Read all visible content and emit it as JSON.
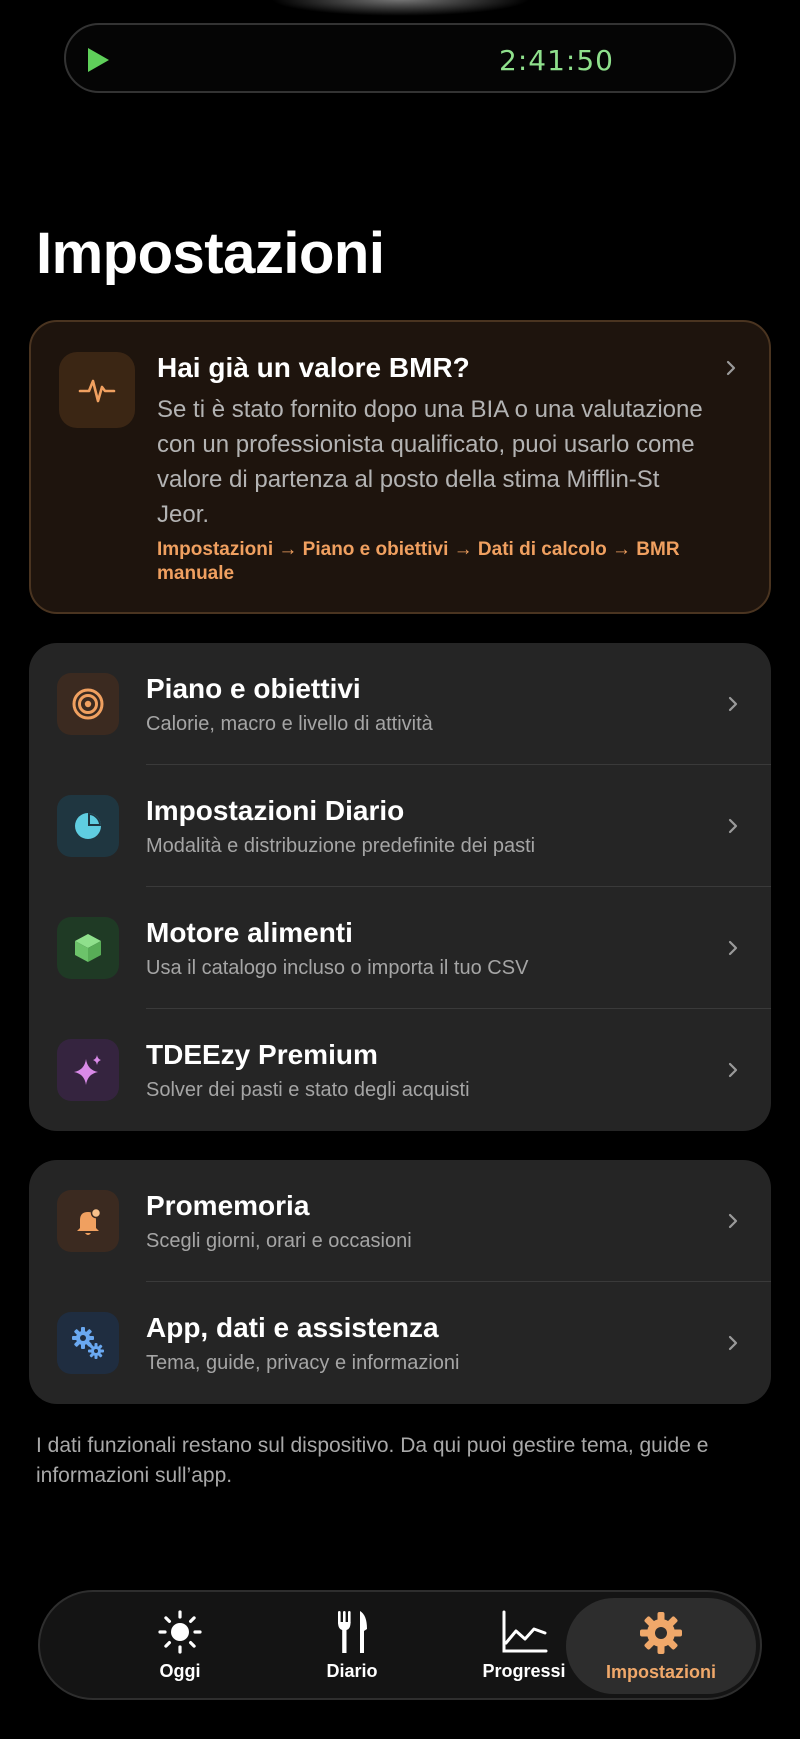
{
  "activity": {
    "timer": "2:41:50"
  },
  "page_title": "Impostazioni",
  "bmr_card": {
    "heading": "Hai già un valore BMR?",
    "body": "Se ti è stato fornito dopo una BIA o una valutazione con un professionista qualificato, puoi usarlo come valore di partenza al posto della stima Mifflin-St Jeor.",
    "path": "Impostazioni → Piano e obiettivi → Dati di calcolo → BMR manuale"
  },
  "group1": [
    {
      "title": "Piano e obiettivi",
      "subtitle": "Calorie, macro e livello di attività",
      "icon": "target-icon"
    },
    {
      "title": "Impostazioni Diario",
      "subtitle": "Modalità e distribuzione predefinite dei pasti",
      "icon": "pie-chart-icon"
    },
    {
      "title": "Motore alimenti",
      "subtitle": "Usa il catalogo incluso o importa il tuo CSV",
      "icon": "cube-icon"
    },
    {
      "title": "TDEEzy Premium",
      "subtitle": "Solver dei pasti e stato degli acquisti",
      "icon": "sparkles-icon"
    }
  ],
  "group2": [
    {
      "title": "Promemoria",
      "subtitle": "Scegli giorni, orari e occasioni",
      "icon": "bell-icon"
    },
    {
      "title": "App, dati e assistenza",
      "subtitle": "Tema, guide, privacy e informazioni",
      "icon": "gears-icon"
    }
  ],
  "footnote": "I dati funzionali restano sul dispositivo. Da qui puoi gestire tema, guide e informazioni sull’app.",
  "tabs": [
    {
      "label": "Oggi",
      "icon": "sun-icon"
    },
    {
      "label": "Diario",
      "icon": "fork-knife-icon"
    },
    {
      "label": "Progressi",
      "icon": "line-chart-icon"
    },
    {
      "label": "Impostazioni",
      "icon": "gear-icon",
      "active": true
    }
  ],
  "colors": {
    "accent": "#f0a86a",
    "timer": "#8fe08c",
    "background": "#000000",
    "card": "#252525"
  }
}
